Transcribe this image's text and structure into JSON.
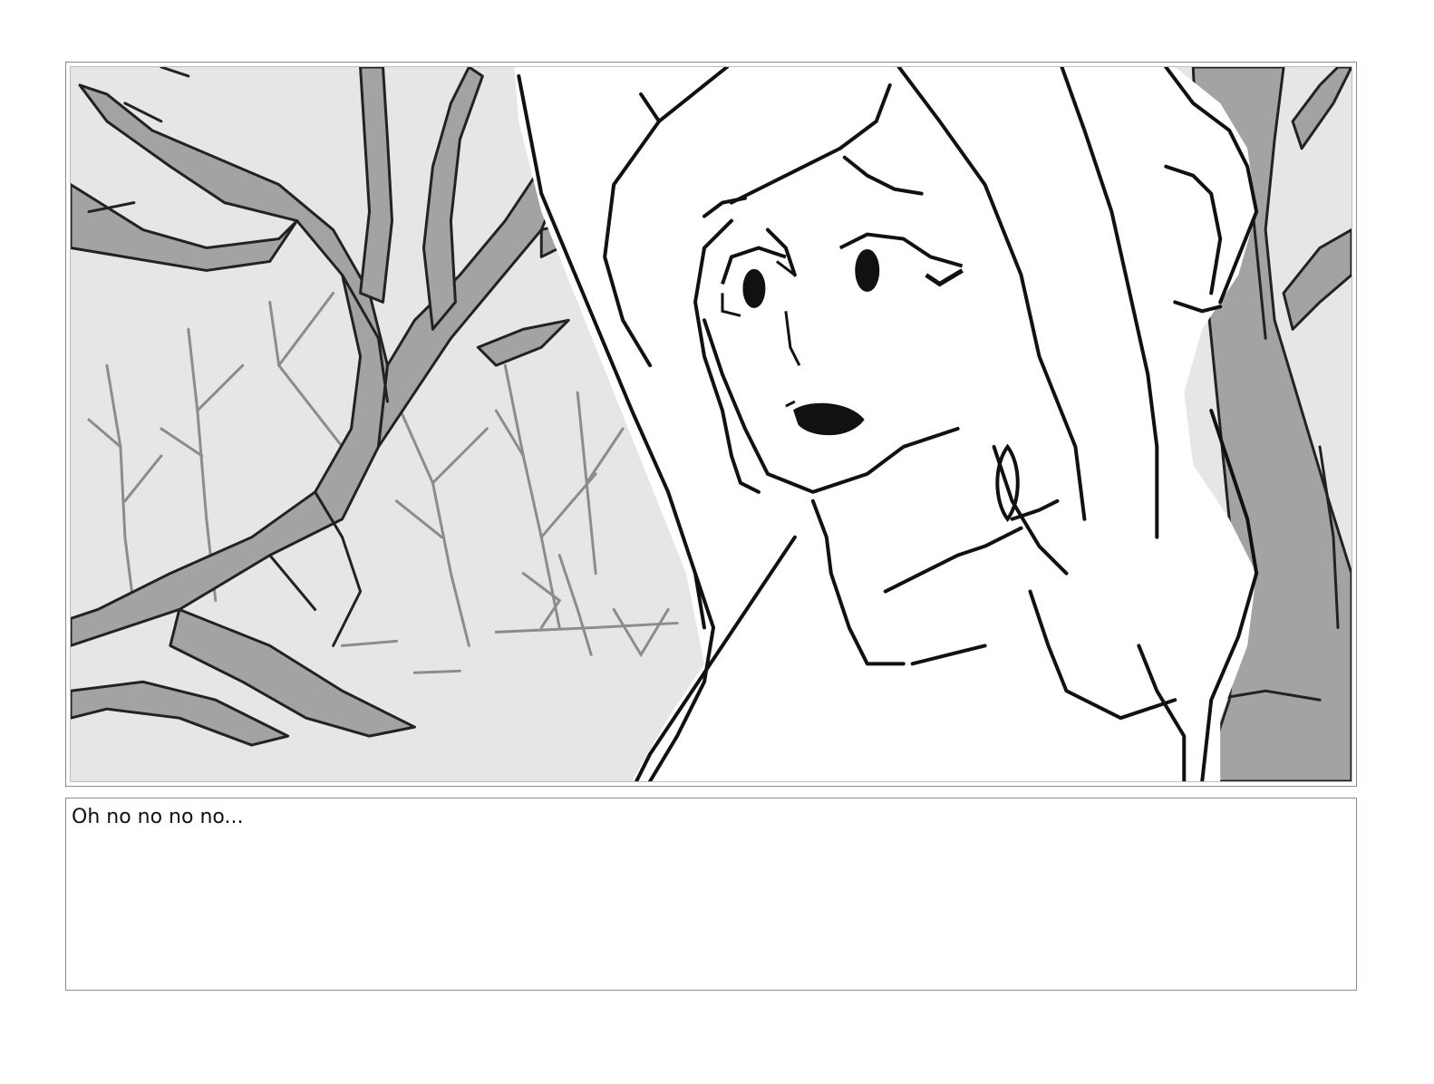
{
  "storyboard": {
    "panel": {
      "illustration": "storyboard-sketch"
    },
    "caption": {
      "dialogue": "Oh no no no no..."
    }
  },
  "colors": {
    "background_fill": "#e6e6e6",
    "tree_fill": "#a3a3a3",
    "ink": "#111111",
    "character_fill": "#ffffff",
    "frame_border": "#8a8a8a"
  }
}
